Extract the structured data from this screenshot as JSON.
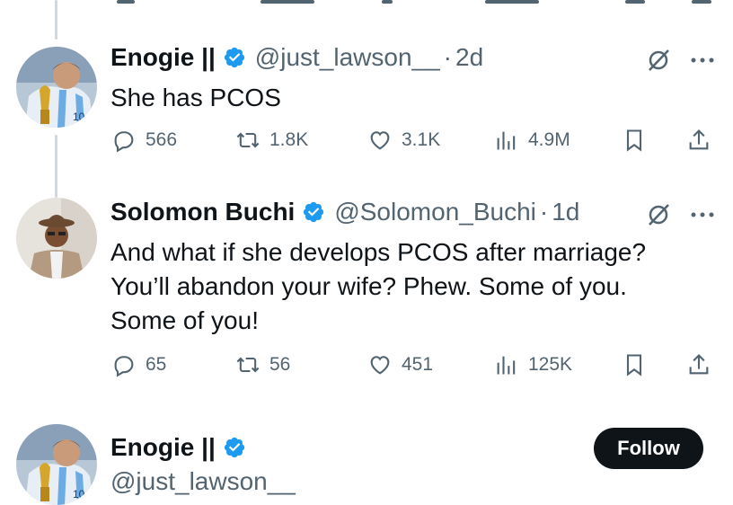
{
  "tweets": [
    {
      "name": "Enogie ||",
      "handle": "@just_lawson__",
      "time": "2d",
      "text": [
        "She has PCOS"
      ],
      "replies": "566",
      "reposts": "1.8K",
      "likes": "3.1K",
      "views": "4.9M"
    },
    {
      "name": "Solomon Buchi",
      "handle": "@Solomon_Buchi",
      "time": "1d",
      "text": [
        "And what if she develops PCOS after marriage?",
        "You’ll abandon your wife? Phew. Some of you.",
        "Some of you!"
      ],
      "replies": "65",
      "reposts": "56",
      "likes": "451",
      "views": "125K"
    }
  ],
  "profile": {
    "name": "Enogie ||",
    "handle": "@just_lawson__",
    "follow_label": "Follow"
  },
  "separator": "·",
  "colors": {
    "verified": "#1d9bf0",
    "secondary": "#536471",
    "primary": "#0f1419"
  },
  "icons": [
    "verified-badge-icon",
    "grok-icon",
    "more-icon",
    "reply-icon",
    "repost-icon",
    "like-icon",
    "views-icon",
    "bookmark-icon",
    "share-icon"
  ]
}
